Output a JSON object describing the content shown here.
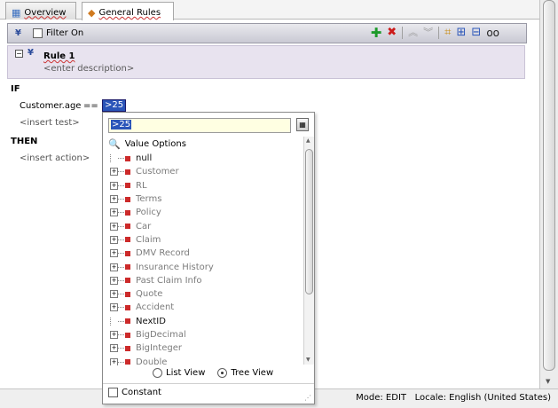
{
  "tabs": [
    {
      "label": "Overview",
      "icon": "overview-icon"
    },
    {
      "label": "General Rules",
      "icon": "rules-diamond-icon"
    }
  ],
  "ruleset_toolbar": {
    "filter_label": "Filter On",
    "filter_checked": false,
    "tool_icons": [
      "add-icon",
      "delete-icon",
      "move-up-icon",
      "move-down-icon",
      "tree-mode-icon",
      "expand-all-icon",
      "collapse-all-icon",
      "show-details-icon"
    ]
  },
  "rule": {
    "name": "Rule 1",
    "description_placeholder": "<enter description>"
  },
  "if_label": "IF",
  "condition": {
    "lhs": "Customer.age",
    "op": "==",
    "value": ">25"
  },
  "insert_test": "<insert test>",
  "then_label": "THEN",
  "insert_action": "<insert action>",
  "popup": {
    "input_value": ">25",
    "tree_header": "Value Options",
    "items": [
      {
        "label": "null",
        "expandable": false,
        "dark": true
      },
      {
        "label": "Customer",
        "expandable": true,
        "dark": false
      },
      {
        "label": "RL",
        "expandable": true,
        "dark": false
      },
      {
        "label": "Terms",
        "expandable": true,
        "dark": false
      },
      {
        "label": "Policy",
        "expandable": true,
        "dark": false
      },
      {
        "label": "Car",
        "expandable": true,
        "dark": false
      },
      {
        "label": "Claim",
        "expandable": true,
        "dark": false
      },
      {
        "label": "DMV Record",
        "expandable": true,
        "dark": false
      },
      {
        "label": "Insurance History",
        "expandable": true,
        "dark": false
      },
      {
        "label": "Past Claim Info",
        "expandable": true,
        "dark": false
      },
      {
        "label": "Quote",
        "expandable": true,
        "dark": false
      },
      {
        "label": "Accident",
        "expandable": true,
        "dark": false
      },
      {
        "label": "NextID",
        "expandable": false,
        "dark": true
      },
      {
        "label": "BigDecimal",
        "expandable": true,
        "dark": false
      },
      {
        "label": "BigInteger",
        "expandable": true,
        "dark": false
      },
      {
        "label": "Double",
        "expandable": true,
        "dark": false
      }
    ],
    "list_view_label": "List View",
    "tree_view_label": "Tree View",
    "selected_view": "Tree View",
    "constant_label": "Constant",
    "constant_checked": false
  },
  "status": {
    "mode": "Mode: EDIT",
    "locale": "Locale: English (United States)"
  }
}
